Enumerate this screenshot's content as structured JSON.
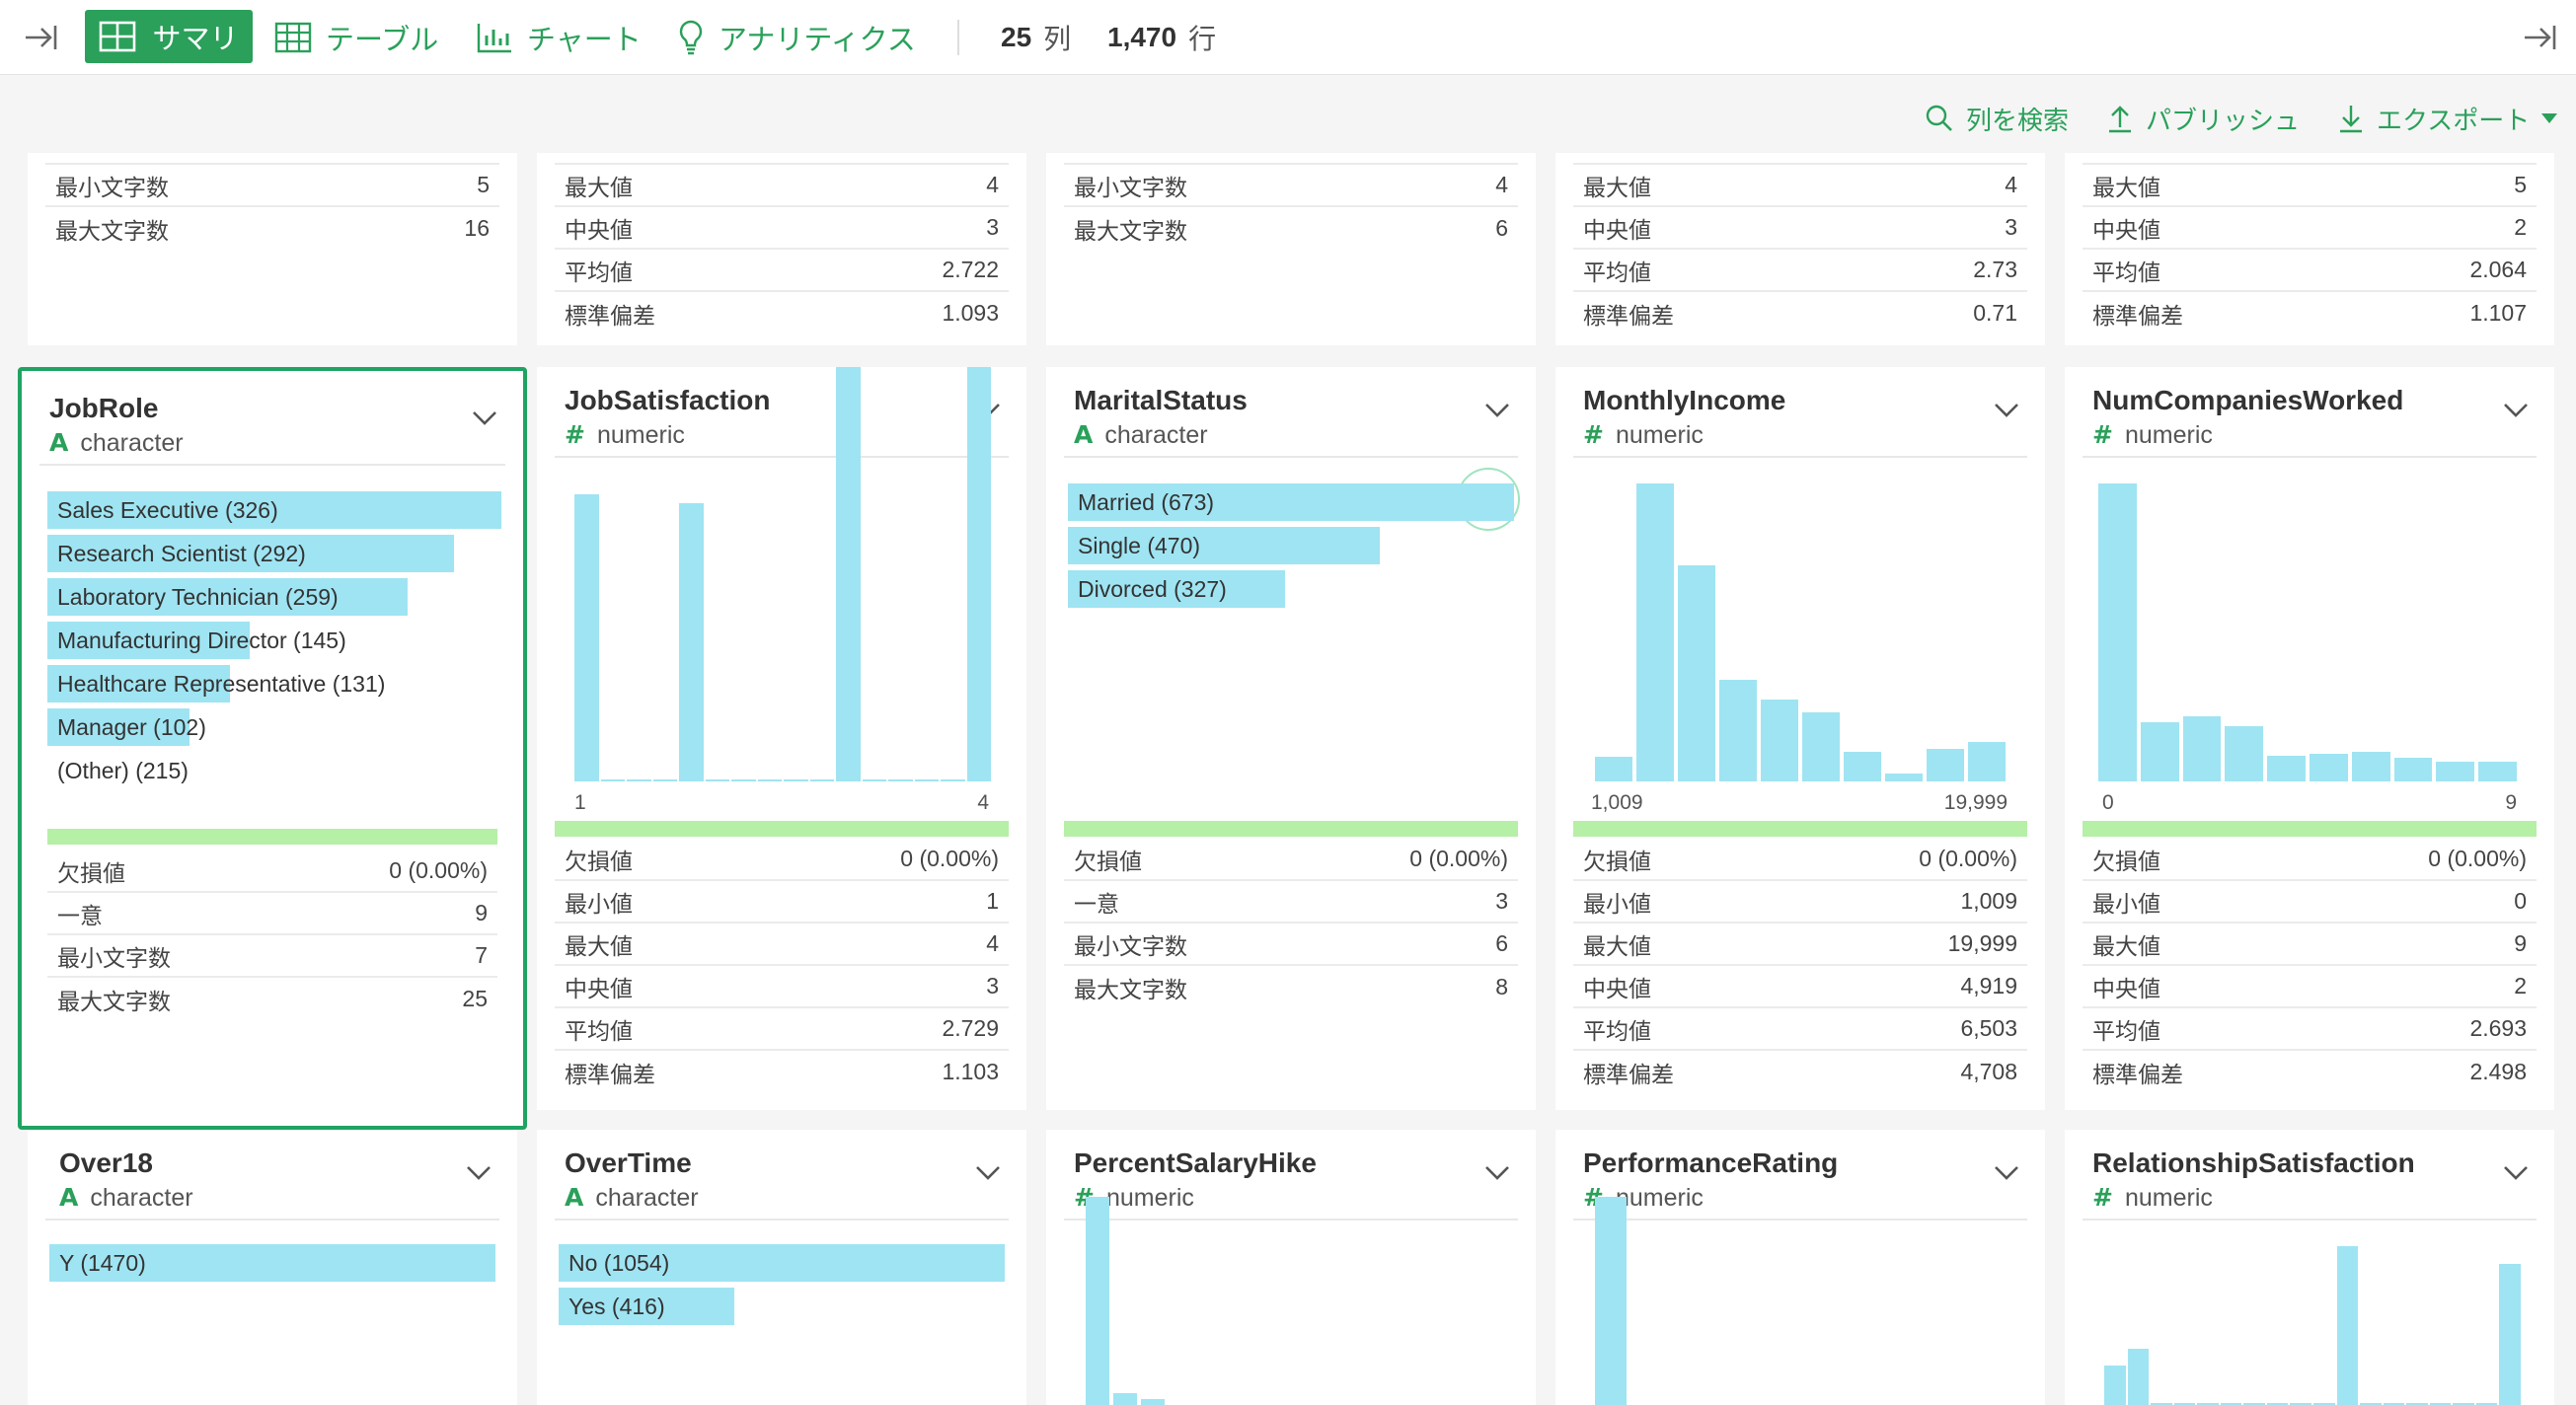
{
  "toolbar": {
    "tabs": [
      {
        "label": "サマリ",
        "icon": "grid-icon",
        "active": true
      },
      {
        "label": "テーブル",
        "icon": "table-icon"
      },
      {
        "label": "チャート",
        "icon": "bar-chart-icon"
      },
      {
        "label": "アナリティクス",
        "icon": "lightbulb-icon"
      }
    ],
    "col_count": "25",
    "col_unit": "列",
    "row_count": "1,470",
    "row_unit": "行"
  },
  "actions": {
    "search": "列を検索",
    "publish": "パブリッシュ",
    "export": "エクスポート"
  },
  "colors": {
    "accent": "#2aa05a",
    "bar": "#9fe4f2",
    "quality": "#b6efa6",
    "selected": "#1fa362"
  },
  "top_partial": [
    {
      "rows": [
        [
          "最小文字数",
          "5"
        ],
        [
          "最大文字数",
          "16"
        ]
      ]
    },
    {
      "rows": [
        [
          "最大値",
          "4"
        ],
        [
          "中央値",
          "3"
        ],
        [
          "平均値",
          "2.722"
        ],
        [
          "標準偏差",
          "1.093"
        ]
      ]
    },
    {
      "rows": [
        [
          "最小文字数",
          "4"
        ],
        [
          "最大文字数",
          "6"
        ]
      ]
    },
    {
      "rows": [
        [
          "最大値",
          "4"
        ],
        [
          "中央値",
          "3"
        ],
        [
          "平均値",
          "2.73"
        ],
        [
          "標準偏差",
          "0.71"
        ]
      ]
    },
    {
      "rows": [
        [
          "最大値",
          "5"
        ],
        [
          "中央値",
          "2"
        ],
        [
          "平均値",
          "2.064"
        ],
        [
          "標準偏差",
          "1.107"
        ]
      ]
    }
  ],
  "columns": [
    {
      "name": "JobRole",
      "type_glyph": "A",
      "type": "character",
      "selected": true,
      "categories": [
        {
          "label": "Sales Executive (326)",
          "count": 326
        },
        {
          "label": "Research Scientist (292)",
          "count": 292
        },
        {
          "label": "Laboratory Technician (259)",
          "count": 259
        },
        {
          "label": "Manufacturing Director (145)",
          "count": 145
        },
        {
          "label": "Healthcare Representative (131)",
          "count": 131
        },
        {
          "label": "Manager (102)",
          "count": 102
        },
        {
          "label": "(Other) (215)",
          "count": 0
        }
      ],
      "stats": [
        [
          "欠損値",
          "0 (0.00%)"
        ],
        [
          "一意",
          "9"
        ],
        [
          "最小文字数",
          "7"
        ],
        [
          "最大文字数",
          "25"
        ]
      ]
    },
    {
      "name": "JobSatisfaction",
      "type_glyph": "#",
      "type": "numeric",
      "hist": [
        289,
        0,
        0,
        0,
        280,
        0,
        0,
        0,
        0,
        0,
        459,
        0,
        0,
        0,
        0,
        442
      ],
      "axis_min": "1",
      "axis_max": "4",
      "stats": [
        [
          "欠損値",
          "0 (0.00%)"
        ],
        [
          "最小値",
          "1"
        ],
        [
          "最大値",
          "4"
        ],
        [
          "中央値",
          "3"
        ],
        [
          "平均値",
          "2.729"
        ],
        [
          "標準偏差",
          "1.103"
        ]
      ]
    },
    {
      "name": "MaritalStatus",
      "type_glyph": "A",
      "type": "character",
      "categories": [
        {
          "label": "Married (673)",
          "count": 673
        },
        {
          "label": "Single (470)",
          "count": 470
        },
        {
          "label": "Divorced (327)",
          "count": 327
        }
      ],
      "stats": [
        [
          "欠損値",
          "0 (0.00%)"
        ],
        [
          "一意",
          "3"
        ],
        [
          "最小文字数",
          "6"
        ],
        [
          "最大文字数",
          "8"
        ]
      ]
    },
    {
      "name": "MonthlyIncome",
      "type_glyph": "#",
      "type": "numeric",
      "hist": [
        25,
        300,
        218,
        102,
        82,
        70,
        30,
        8,
        33,
        40
      ],
      "axis_min": "1,009",
      "axis_max": "19,999",
      "stats": [
        [
          "欠損値",
          "0 (0.00%)"
        ],
        [
          "最小値",
          "1,009"
        ],
        [
          "最大値",
          "19,999"
        ],
        [
          "中央値",
          "4,919"
        ],
        [
          "平均値",
          "6,503"
        ],
        [
          "標準偏差",
          "4,708"
        ]
      ]
    },
    {
      "name": "NumCompaniesWorked",
      "type_glyph": "#",
      "type": "numeric",
      "hist": [
        300,
        60,
        66,
        56,
        26,
        28,
        30,
        24,
        20,
        20
      ],
      "axis_min": "0",
      "axis_max": "9",
      "stats": [
        [
          "欠損値",
          "0 (0.00%)"
        ],
        [
          "最小値",
          "0"
        ],
        [
          "最大値",
          "9"
        ],
        [
          "中央値",
          "2"
        ],
        [
          "平均値",
          "2.693"
        ],
        [
          "標準偏差",
          "2.498"
        ]
      ]
    },
    {
      "name": "Over18",
      "type_glyph": "A",
      "type": "character",
      "categories": [
        {
          "label": "Y (1470)",
          "count": 1470
        }
      ]
    },
    {
      "name": "OverTime",
      "type_glyph": "A",
      "type": "character",
      "categories": [
        {
          "label": "No (1054)",
          "count": 1054
        },
        {
          "label": "Yes (416)",
          "count": 416
        }
      ]
    },
    {
      "name": "PercentSalaryHike",
      "type_glyph": "#",
      "type": "numeric",
      "hist": [
        210,
        12,
        6
      ]
    },
    {
      "name": "PerformanceRating",
      "type_glyph": "#",
      "type": "numeric",
      "hist": [
        210
      ]
    },
    {
      "name": "RelationshipSatisfaction",
      "type_glyph": "#",
      "type": "numeric",
      "hist": [
        40,
        57,
        0,
        0,
        0,
        0,
        0,
        0,
        0,
        0,
        160,
        0,
        0,
        0,
        0,
        0,
        0,
        142
      ]
    }
  ]
}
